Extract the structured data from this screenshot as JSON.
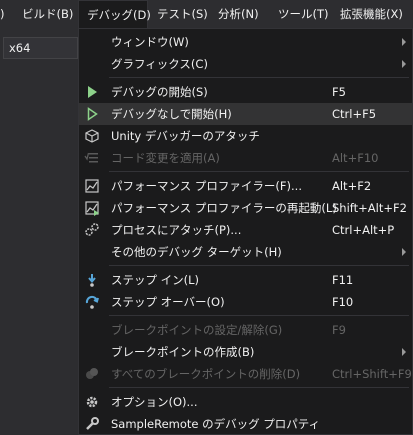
{
  "menubar": {
    "items": [
      {
        "label": ")"
      },
      {
        "label": "ビルド(B)"
      },
      {
        "label": "デバッグ(D)"
      },
      {
        "label": "テスト(S)"
      },
      {
        "label": "分析(N)"
      },
      {
        "label": "ツール(T)"
      },
      {
        "label": "拡張機能(X)"
      }
    ]
  },
  "toolbar": {
    "platform_value": "x64"
  },
  "menu": {
    "items": [
      {
        "label": "ウィンドウ(W)",
        "shortcut": ""
      },
      {
        "label": "グラフィックス(C)",
        "shortcut": ""
      },
      {
        "label": "デバッグの開始(S)",
        "shortcut": "F5"
      },
      {
        "label": "デバッグなしで開始(H)",
        "shortcut": "Ctrl+F5"
      },
      {
        "label": "Unity デバッガーのアタッチ",
        "shortcut": ""
      },
      {
        "label": "コード変更を適用(A)",
        "shortcut": "Alt+F10"
      },
      {
        "label": "パフォーマンス プロファイラー(F)...",
        "shortcut": "Alt+F2"
      },
      {
        "label": "パフォーマンス プロファイラーの再起動(L)",
        "shortcut": "Shift+Alt+F2"
      },
      {
        "label": "プロセスにアタッチ(P)...",
        "shortcut": "Ctrl+Alt+P"
      },
      {
        "label": "その他のデバッグ ターゲット(H)",
        "shortcut": ""
      },
      {
        "label": "ステップ イン(L)",
        "shortcut": "F11"
      },
      {
        "label": "ステップ オーバー(O)",
        "shortcut": "F10"
      },
      {
        "label": "ブレークポイントの設定/解除(G)",
        "shortcut": "F9"
      },
      {
        "label": "ブレークポイントの作成(B)",
        "shortcut": ""
      },
      {
        "label": "すべてのブレークポイントの削除(D)",
        "shortcut": "Ctrl+Shift+F9"
      },
      {
        "label": "オプション(O)...",
        "shortcut": ""
      },
      {
        "label": "SampleRemote のデバッグ プロパティ",
        "shortcut": ""
      }
    ]
  },
  "colors": {
    "menu_bg": "#1b1b1c",
    "highlight": "#333334",
    "play_green": "#8dd28a",
    "step_blue": "#57a6d9",
    "disabled_text": "#656565"
  }
}
